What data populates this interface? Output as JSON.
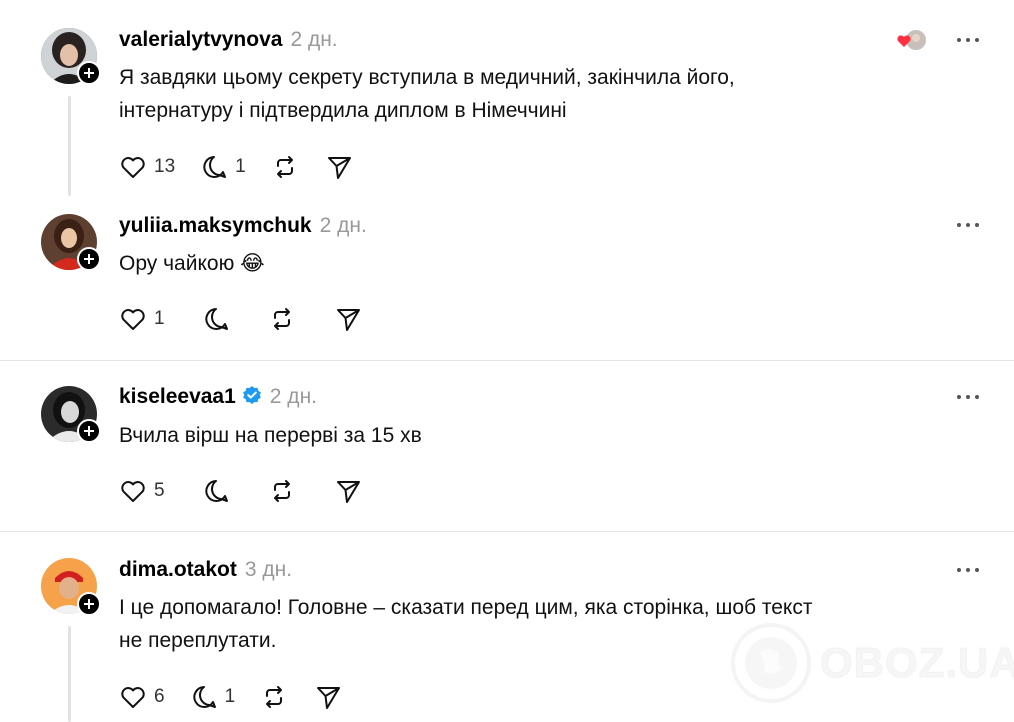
{
  "comments": [
    {
      "username": "valerialytvynova",
      "time": "2 дн.",
      "text_lines": [
        "Я завдяки цьому секрету вступила в медичний, закінчила його,",
        "інтернатуру і підтвердила диплом в Німеччині"
      ],
      "likes": "13",
      "replies": "1",
      "avatar_icon": "avatar-woman-dark-hair",
      "reply_reaction_icon": "heart-icon"
    },
    {
      "username": "yuliia.maksymchuk",
      "time": "2 дн.",
      "text": "Ору чайкою 😂",
      "likes": "1",
      "avatar_icon": "avatar-woman-red-top"
    },
    {
      "username": "kiseleevaa1",
      "time": "2 дн.",
      "verified": true,
      "text": "Вчила вірш на перерві за 15 хв",
      "likes": "5",
      "avatar_icon": "avatar-woman-bw"
    },
    {
      "username": "dima.otakot",
      "time": "3 дн.",
      "text_lines": [
        "І це допомагало! Головне – сказати перед цим, яка сторінка, шоб текст",
        "не переплутати."
      ],
      "likes": "6",
      "replies": "1",
      "avatar_icon": "avatar-man-red-cap"
    }
  ],
  "watermark": {
    "text": "OBOZ.UA"
  },
  "colors": {
    "verified": "#1d9bf0",
    "like_heart": "#ff3040",
    "muted": "#999999"
  }
}
